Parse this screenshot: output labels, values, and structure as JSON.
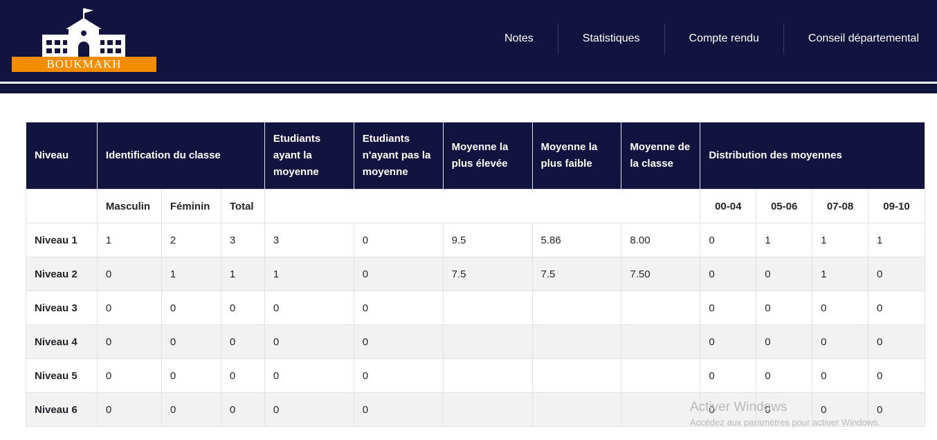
{
  "brand": {
    "name": "BOUKMAKH",
    "colors": {
      "header": "#13133f",
      "accent": "#f28c00"
    }
  },
  "nav": {
    "items": [
      {
        "label": "Notes"
      },
      {
        "label": "Statistiques"
      },
      {
        "label": "Compte rendu"
      },
      {
        "label": "Conseil départemental"
      }
    ]
  },
  "table": {
    "headers": {
      "niveau": "Niveau",
      "identification": "Identification du classe",
      "ayant": "Etudiants ayant la moyenne",
      "nayant": "Etudiants n'ayant pas la moyenne",
      "max": "Moyenne la plus élevée",
      "min": "Moyenne la plus faible",
      "avg": "Moyenne de la classe",
      "distribution": "Distribution des moyennes"
    },
    "subheaders": {
      "masculin": "Masculin",
      "feminin": "Féminin",
      "total": "Total",
      "d1": "00-04",
      "d2": "05-06",
      "d3": "07-08",
      "d4": "09-10"
    },
    "rows": [
      {
        "niveau": "Niveau 1",
        "masculin": "1",
        "feminin": "2",
        "total": "3",
        "ayant": "3",
        "nayant": "0",
        "max": "9.5",
        "min": "5.86",
        "avg": "8.00",
        "d1": "0",
        "d2": "1",
        "d3": "1",
        "d4": "1"
      },
      {
        "niveau": "Niveau 2",
        "masculin": "0",
        "feminin": "1",
        "total": "1",
        "ayant": "1",
        "nayant": "0",
        "max": "7.5",
        "min": "7.5",
        "avg": "7.50",
        "d1": "0",
        "d2": "0",
        "d3": "1",
        "d4": "0"
      },
      {
        "niveau": "Niveau 3",
        "masculin": "0",
        "feminin": "0",
        "total": "0",
        "ayant": "0",
        "nayant": "0",
        "max": "",
        "min": "",
        "avg": "",
        "d1": "0",
        "d2": "0",
        "d3": "0",
        "d4": "0"
      },
      {
        "niveau": "Niveau 4",
        "masculin": "0",
        "feminin": "0",
        "total": "0",
        "ayant": "0",
        "nayant": "0",
        "max": "",
        "min": "",
        "avg": "",
        "d1": "0",
        "d2": "0",
        "d3": "0",
        "d4": "0"
      },
      {
        "niveau": "Niveau 5",
        "masculin": "0",
        "feminin": "0",
        "total": "0",
        "ayant": "0",
        "nayant": "0",
        "max": "",
        "min": "",
        "avg": "",
        "d1": "0",
        "d2": "0",
        "d3": "0",
        "d4": "0"
      },
      {
        "niveau": "Niveau 6",
        "masculin": "0",
        "feminin": "0",
        "total": "0",
        "ayant": "0",
        "nayant": "0",
        "max": "",
        "min": "",
        "avg": "",
        "d1": "0",
        "d2": "0",
        "d3": "0",
        "d4": "0"
      }
    ]
  },
  "watermark": {
    "title": "Activer Windows",
    "subtitle": "Accédez aux paramètres pour activer Windows."
  }
}
